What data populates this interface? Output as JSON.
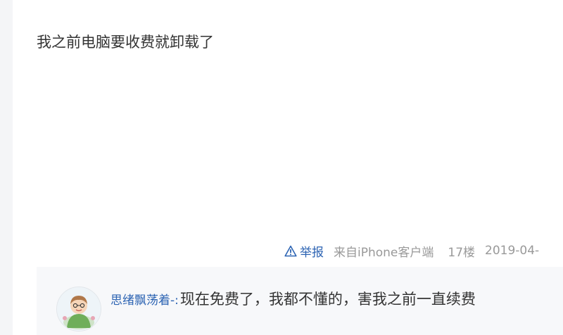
{
  "post": {
    "content": "我之前电脑要收费就卸载了"
  },
  "post_tail": {
    "report_label": "举报",
    "client": "来自iPhone客户端",
    "floor": "17楼",
    "date": "2019-04-"
  },
  "reply": {
    "username": "思绪飘荡着-:",
    "text": "现在免费了，我都不懂的，害我之前一直续费"
  },
  "colors": {
    "link": "#2d64b3",
    "meta": "#999999",
    "text": "#333333",
    "reply_bg": "#f7f8fa"
  },
  "icons": {
    "report": "warning-triangle-icon",
    "avatar": "cartoon-avatar"
  }
}
